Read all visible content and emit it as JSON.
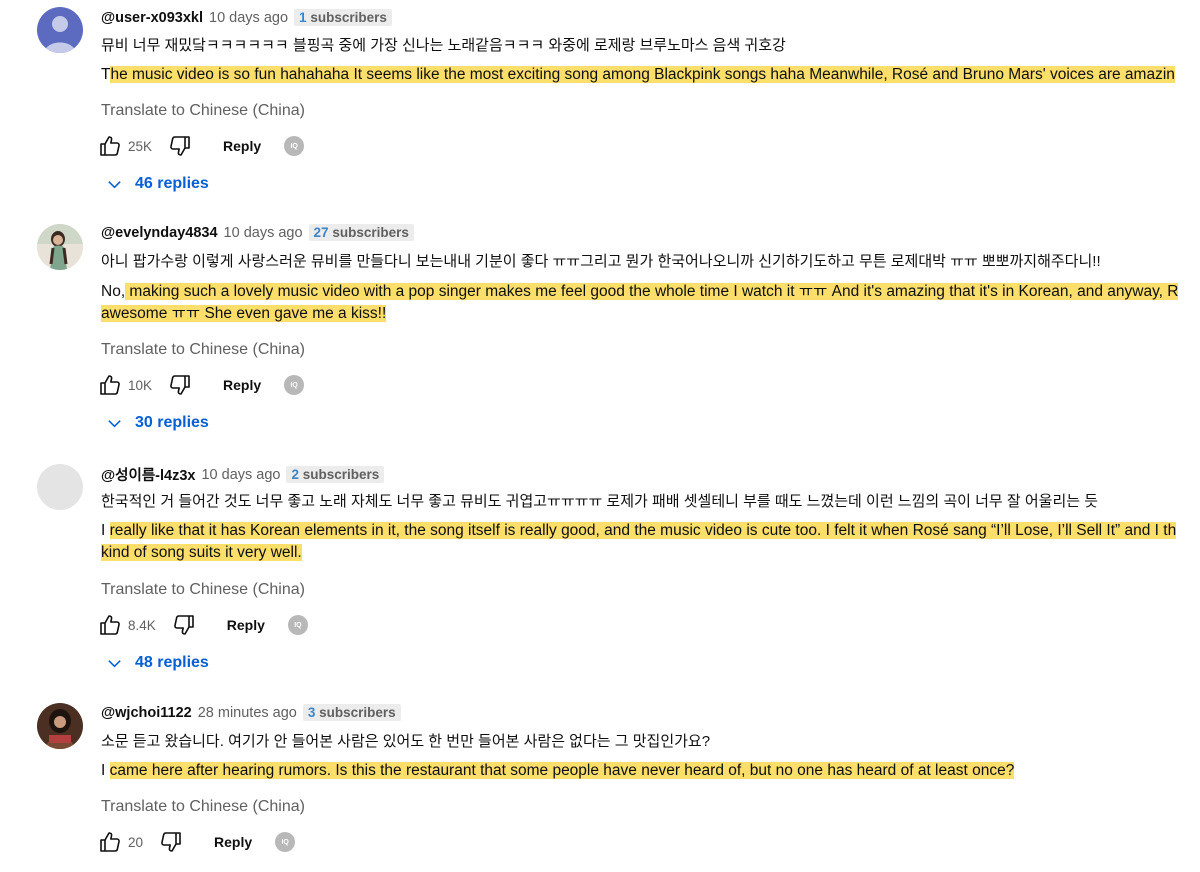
{
  "actions": {
    "reply_label": "Reply",
    "iq_badge": "IQ"
  },
  "translate_label": "Translate to Chinese (China)",
  "comments": [
    {
      "handle": "@user-x093xkl",
      "time": "10 days ago",
      "sub_count": "1",
      "sub_word": "subscribers",
      "korean": "뮤비 너무 재밌닼ㅋㅋㅋㅋㅋㅋ 블핑곡 중에 가장 신나는 노래같음ㅋㅋㅋ 와중에 로제랑 브루노마스 음색 귀호강",
      "translation_lines": [
        "The music video is so fun hahahaha It seems like the most exciting song among Blackpink songs haha Meanwhile, Rosé and Bruno Mars' voices are amazin"
      ],
      "likes": "25K",
      "replies": "46 replies"
    },
    {
      "handle": "@evelynday4834",
      "time": "10 days ago",
      "sub_count": "27",
      "sub_word": "subscribers",
      "korean": "아니 팝가수랑 이렇게 사랑스러운 뮤비를 만들다니 보는내내 기분이 좋다 ㅠㅠ그리고 뭔가 한국어나오니까 신기하기도하고 무튼 로제대박 ㅠㅠ 뽀뽀까지해주다니!!",
      "translation_lines": [
        "No, making such a lovely music video with a pop singer makes me feel good the whole time I watch it ㅠㅠ And it's amazing that it's in Korean, and anyway, R",
        "awesome ㅠㅠ She even gave me a kiss!!"
      ],
      "likes": "10K",
      "replies": "30 replies"
    },
    {
      "handle": "@성이름-l4z3x",
      "time": "10 days ago",
      "sub_count": "2",
      "sub_word": "subscribers",
      "korean": "한국적인 거 들어간 것도 너무 좋고 노래 자체도 너무 좋고 뮤비도 귀엽고ㅠㅠㅠㅠ 로제가 패배 셋셀테니 부를 때도 느꼈는데 이런 느낌의 곡이 너무 잘 어울리는 듯",
      "translation_lines": [
        "I really like that it has Korean elements in it, the song itself is really good, and the music video is cute too. I felt it when Rosé sang “I’ll Lose, I’ll Sell It” and I th",
        "kind of song suits it very well."
      ],
      "likes": "8.4K",
      "replies": "48 replies"
    },
    {
      "handle": "@wjchoi1122",
      "time": "28 minutes ago",
      "sub_count": "3",
      "sub_word": "subscribers",
      "korean": "소문 듣고 왔습니다. 여기가 안 들어본 사람은 있어도 한 번만 들어본 사람은 없다는 그 맛집인가요?",
      "translation_lines": [
        "I came here after hearing rumors. Is this the restaurant that some people have never heard of, but no one has heard of at least once?"
      ],
      "likes": "20"
    }
  ]
}
